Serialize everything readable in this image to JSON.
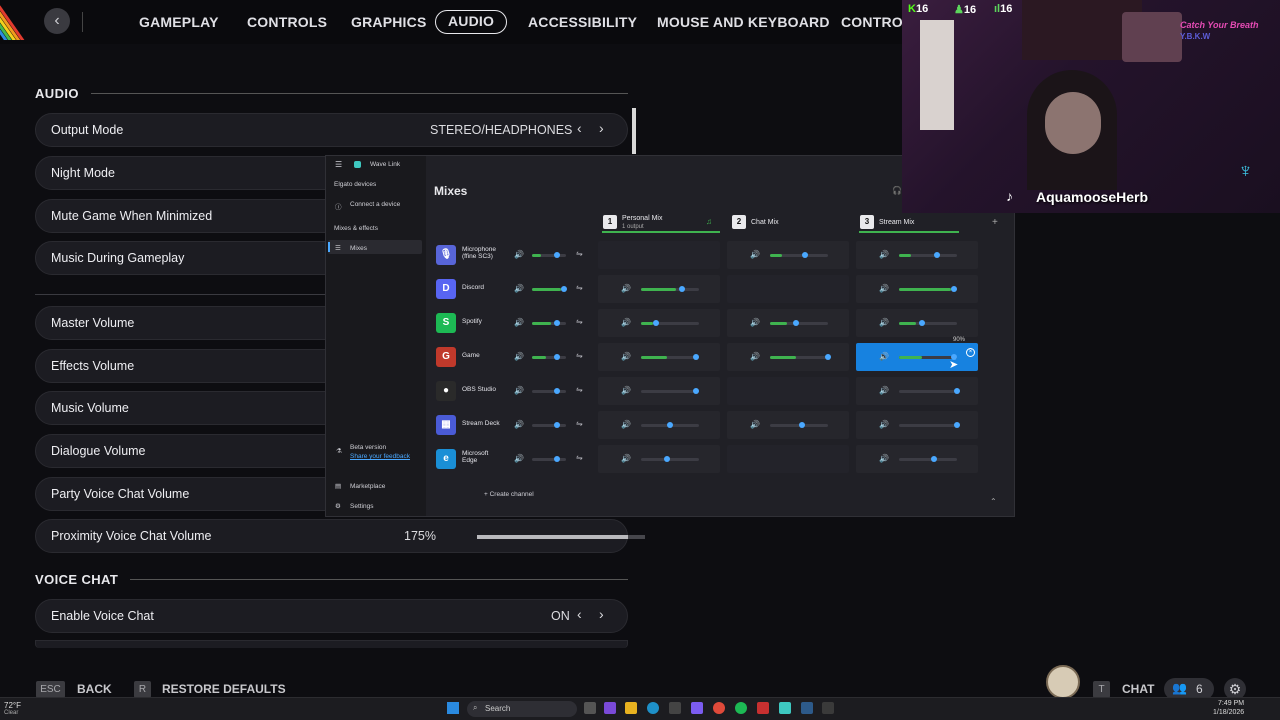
{
  "topnav": {
    "tabs": [
      "GAMEPLAY",
      "CONTROLS",
      "GRAPHICS",
      "AUDIO",
      "ACCESSIBILITY",
      "MOUSE AND KEYBOARD",
      "CONTROL"
    ],
    "active_tab": "AUDIO"
  },
  "audio": {
    "section_title": "AUDIO",
    "output_mode": {
      "label": "Output Mode",
      "value": "STEREO/HEADPHONES"
    },
    "rows": [
      "Night Mode",
      "Mute Game When Minimized",
      "Music During Gameplay"
    ],
    "volume_rows": [
      "Master Volume",
      "Effects Volume",
      "Music Volume",
      "Dialogue Volume",
      "Party Voice Chat Volume"
    ],
    "proximity": {
      "label": "Proximity Voice Chat Volume",
      "value": "175%",
      "level": 0.9
    }
  },
  "voice_chat": {
    "section_title": "VOICE CHAT",
    "enable": {
      "label": "Enable Voice Chat",
      "value": "ON"
    }
  },
  "footer": {
    "back_key": "ESC",
    "back_label": "BACK",
    "restore_key": "R",
    "restore_label": "RESTORE DEFAULTS",
    "chat_key": "T",
    "chat_label": "CHAT",
    "party_count": "6"
  },
  "wavelink": {
    "app_title": "Wave Link",
    "sidebar": {
      "elgato_devices": "Elgato devices",
      "connect": "Connect a device",
      "mixes_effects": "Mixes & effects",
      "mixes": "Mixes",
      "beta": "Beta version",
      "feedback": "Share your feedback",
      "marketplace": "Marketplace",
      "settings": "Settings"
    },
    "title": "Mixes",
    "mixes": [
      {
        "num": "1",
        "name": "Personal Mix",
        "sub": "1 output"
      },
      {
        "num": "2",
        "name": "Chat Mix",
        "sub": ""
      },
      {
        "num": "3",
        "name": "Stream Mix",
        "sub": ""
      }
    ],
    "sources": [
      {
        "name": "Microphone",
        "name2": "(ffine SC3)",
        "color": "#5865d8",
        "glyph": "🎙",
        "levels": [
          0.65,
          null,
          0.55,
          0.6
        ],
        "fills": [
          0.25,
          null,
          0.2,
          0.2
        ]
      },
      {
        "name": "Discord",
        "name2": "",
        "color": "#5865f2",
        "glyph": "D",
        "levels": [
          0.85,
          0.65,
          null,
          0.9
        ],
        "fills": [
          0.85,
          0.6,
          null,
          0.9
        ]
      },
      {
        "name": "Spotify",
        "name2": "",
        "color": "#1db954",
        "glyph": "S",
        "levels": [
          0.65,
          0.2,
          0.4,
          0.35
        ],
        "fills": [
          0.55,
          0.2,
          0.3,
          0.3
        ]
      },
      {
        "name": "Game",
        "name2": "",
        "color": "#c0392b",
        "glyph": "G",
        "levels": [
          0.65,
          0.9,
          0.95,
          0.9
        ],
        "fills": [
          0.4,
          0.45,
          0.45,
          0.4
        ]
      },
      {
        "name": "OBS Studio",
        "name2": "",
        "color": "#2a2a2a",
        "glyph": "●",
        "levels": [
          0.65,
          0.9,
          null,
          0.95
        ],
        "fills": [
          0,
          0,
          null,
          0
        ]
      },
      {
        "name": "Stream Deck",
        "name2": "",
        "color": "#4a5bd6",
        "glyph": "▦",
        "levels": [
          0.65,
          0.45,
          0.5,
          0.95
        ],
        "fills": [
          0,
          0,
          0,
          0
        ]
      },
      {
        "name": "Microsoft",
        "name2": "Edge",
        "color": "#1a8fd6",
        "glyph": "e",
        "levels": [
          0.65,
          0.4,
          null,
          0.55
        ],
        "fills": [
          0,
          0,
          null,
          0
        ]
      }
    ],
    "tooltip": "90%",
    "create_channel": "Create channel"
  },
  "overlay": {
    "streamer": "AquamooseHerb",
    "song": "Catch Your Breath",
    "artist": "Y.B.K.W",
    "stat1": "16",
    "stat2": "16",
    "stat3": "16"
  },
  "taskbar": {
    "search": "Search",
    "weather_temp": "72°F",
    "weather_text": "Clear",
    "time": "7:49 PM",
    "date": "1/18/2026"
  }
}
